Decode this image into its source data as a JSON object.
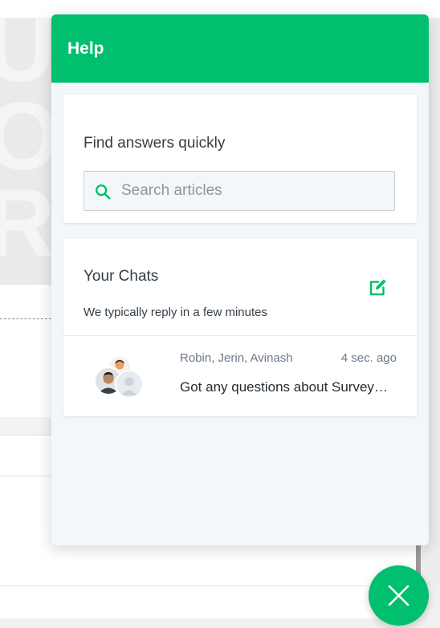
{
  "widget": {
    "title": "Help",
    "search_card": {
      "heading": "Find answers quickly",
      "search_placeholder": "Search articles"
    },
    "chats_card": {
      "heading": "Your Chats",
      "subtitle": "We typically reply in a few minutes",
      "conversations": [
        {
          "participants": "Robin, Jerin, Avinash",
          "time": "4 sec. ago",
          "preview": "Got any questions about SurveySparrow?"
        }
      ]
    }
  },
  "icons": {
    "search": "search-icon",
    "compose": "compose-icon",
    "close": "close-icon"
  },
  "colors": {
    "brand_green": "#00bf6f",
    "widget_bg": "#f4f7f9",
    "text_dark": "#333e48",
    "text_muted": "#6b7a89"
  }
}
